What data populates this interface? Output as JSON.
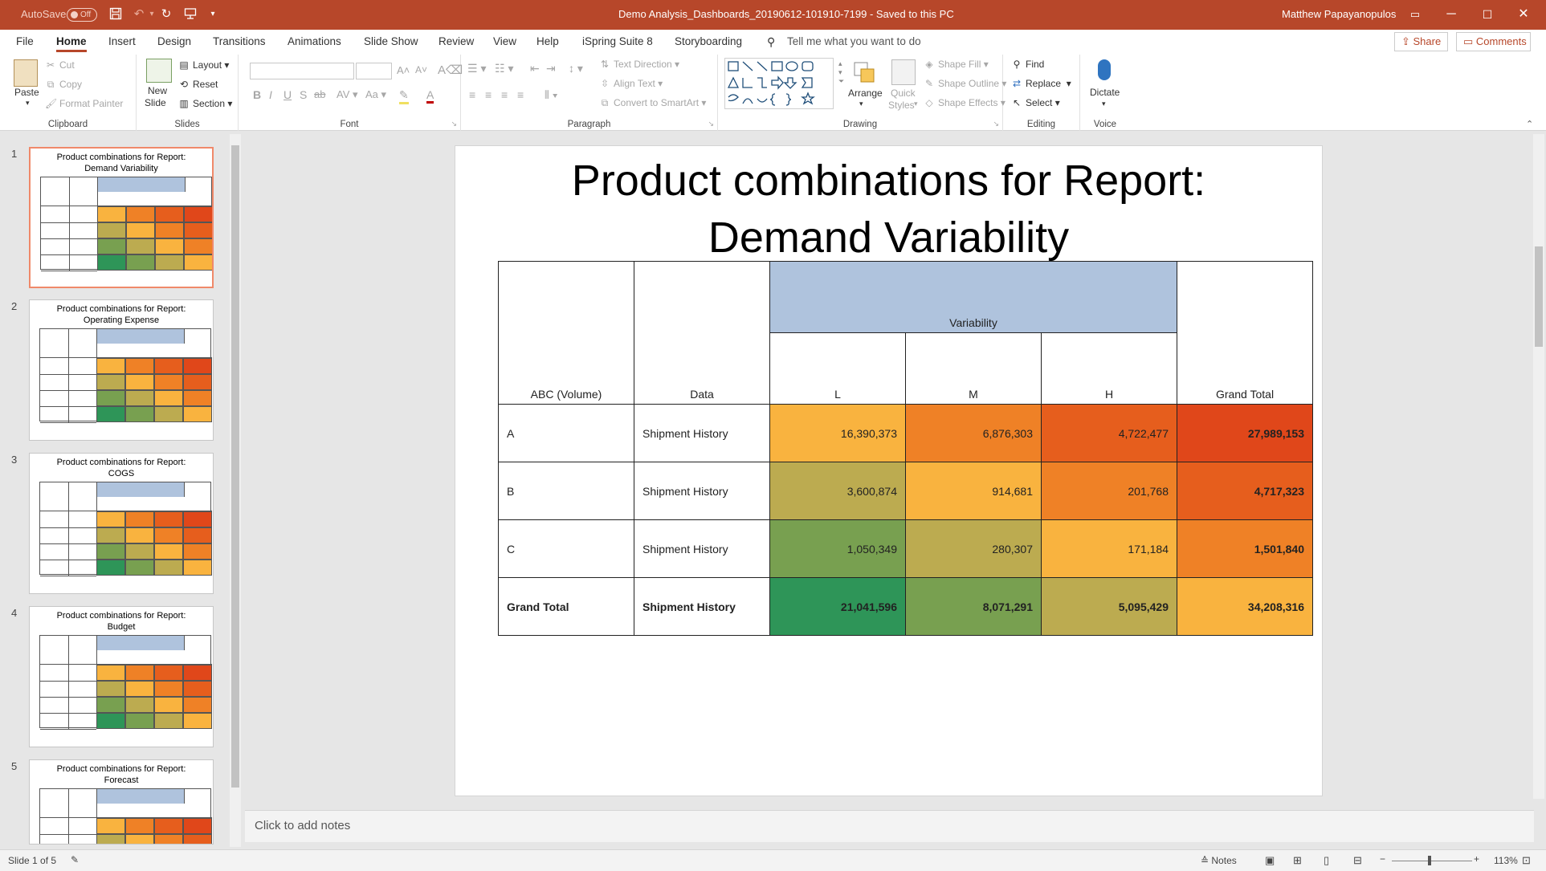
{
  "titlebar": {
    "autosave_label": "AutoSave",
    "autosave_state": "Off",
    "doc_title": "Demo Analysis_Dashboards_20190612-101910-7199  -  Saved to this PC",
    "user_name": "Matthew Papayanopulos",
    "accent_color": "#b7472a"
  },
  "tabs": [
    "File",
    "Home",
    "Insert",
    "Design",
    "Transitions",
    "Animations",
    "Slide Show",
    "Review",
    "View",
    "Help",
    "iSpring Suite 8",
    "Storyboarding"
  ],
  "tell_me": "Tell me what you want to do",
  "share_label": "Share",
  "comments_label": "Comments",
  "ribbon": {
    "clipboard": {
      "paste": "Paste",
      "cut": "Cut",
      "copy": "Copy",
      "format_painter": "Format Painter",
      "label": "Clipboard"
    },
    "slides": {
      "new_slide_1": "New",
      "new_slide_2": "Slide",
      "layout": "Layout",
      "reset": "Reset",
      "section": "Section",
      "label": "Slides"
    },
    "font": {
      "label": "Font"
    },
    "paragraph": {
      "text_direction": "Text Direction",
      "align_text": "Align Text",
      "convert": "Convert to SmartArt",
      "label": "Paragraph"
    },
    "drawing": {
      "arrange": "Arrange",
      "quick_styles_1": "Quick",
      "quick_styles_2": "Styles",
      "shape_fill": "Shape Fill",
      "shape_outline": "Shape Outline",
      "shape_effects": "Shape Effects",
      "label": "Drawing"
    },
    "editing": {
      "find": "Find",
      "replace": "Replace",
      "select": "Select",
      "label": "Editing"
    },
    "voice": {
      "dictate": "Dictate",
      "label": "Voice"
    }
  },
  "thumbnails": [
    {
      "num": "1",
      "title_1": "Product combinations for Report:",
      "title_2": "Demand Variability"
    },
    {
      "num": "2",
      "title_1": "Product combinations for Report:",
      "title_2": "Operating Expense"
    },
    {
      "num": "3",
      "title_1": "Product combinations for Report:",
      "title_2": "COGS"
    },
    {
      "num": "4",
      "title_1": "Product combinations for Report:",
      "title_2": "Budget"
    },
    {
      "num": "5",
      "title_1": "Product combinations for Report:",
      "title_2": "Forecast"
    }
  ],
  "slide": {
    "title_line1": "Product combinations for Report:",
    "title_line2": "Demand Variability",
    "table": {
      "col_header_group": "Variability",
      "headers": {
        "abc": "ABC (Volume)",
        "data": "Data",
        "l": "L",
        "m": "M",
        "h": "H",
        "total": "Grand Total"
      },
      "rows": [
        {
          "abc": "A",
          "data": "Shipment History",
          "l": "16,390,373",
          "m": "6,876,303",
          "h": "4,722,477",
          "total": "27,989,153",
          "colors": [
            "#f9b33f",
            "#ef8126",
            "#e65e1d",
            "#e0471a"
          ]
        },
        {
          "abc": "B",
          "data": "Shipment History",
          "l": "3,600,874",
          "m": "914,681",
          "h": "201,768",
          "total": "4,717,323",
          "colors": [
            "#bcab50",
            "#f9b33f",
            "#ef8126",
            "#e65e1d"
          ]
        },
        {
          "abc": "C",
          "data": "Shipment History",
          "l": "1,050,349",
          "m": "280,307",
          "h": "171,184",
          "total": "1,501,840",
          "colors": [
            "#78a050",
            "#bcab50",
            "#f9b33f",
            "#ef8126"
          ]
        },
        {
          "abc": "Grand Total",
          "data": "Shipment History",
          "l": "21,041,596",
          "m": "8,071,291",
          "h": "5,095,429",
          "total": "34,208,316",
          "colors": [
            "#2e9558",
            "#78a050",
            "#bcab50",
            "#f9b33f"
          ]
        }
      ],
      "header_group_color": "#afc3dd"
    }
  },
  "notes_placeholder": "Click to add notes",
  "status": {
    "slide_count": "Slide 1 of 5",
    "notes": "Notes",
    "zoom": "113%"
  }
}
